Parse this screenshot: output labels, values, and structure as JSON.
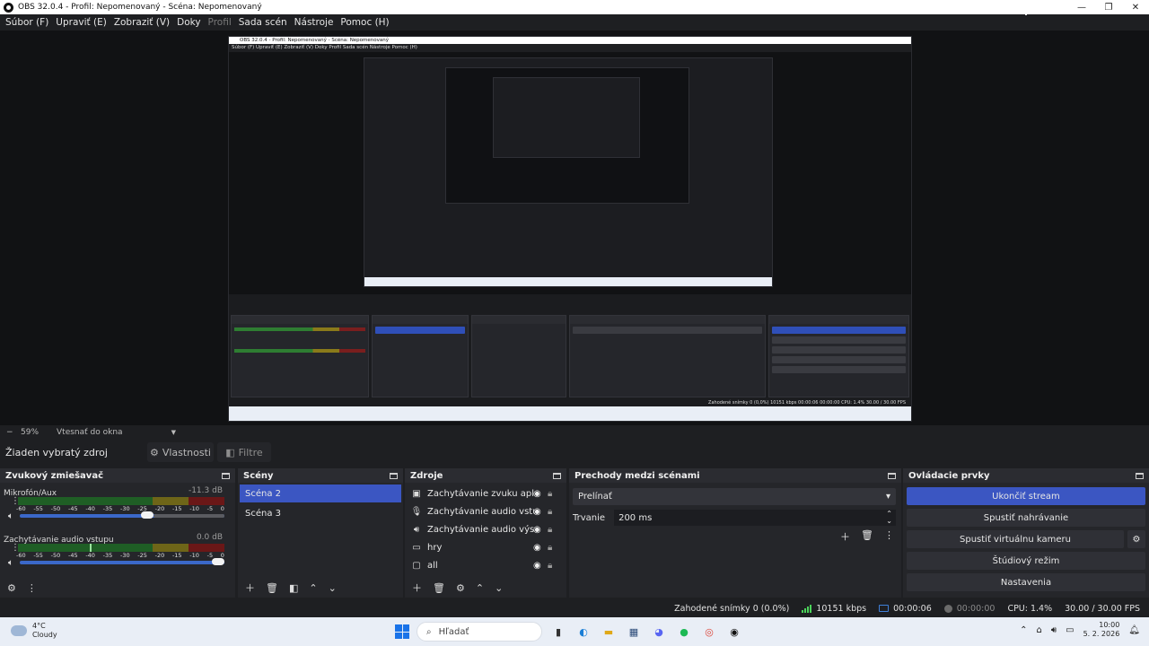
{
  "window": {
    "title": "OBS 32.0.4 - Profil: Nepomenovaný - Scéna: Nepomenovaný",
    "minimize": "—",
    "maximize": "❐",
    "close": "✕"
  },
  "menu": [
    {
      "label": "Súbor (F)",
      "disabled": false
    },
    {
      "label": "Upraviť (E)",
      "disabled": false
    },
    {
      "label": "Zobraziť (V)",
      "disabled": false
    },
    {
      "label": "Doky",
      "disabled": false
    },
    {
      "label": "Profil",
      "disabled": true
    },
    {
      "label": "Sada scén",
      "disabled": false
    },
    {
      "label": "Nástroje",
      "disabled": false
    },
    {
      "label": "Pomoc (H)",
      "disabled": false
    }
  ],
  "preview": {
    "nested_title": "OBS 32.0.4 - Profil: Nepomenovaný - Scéna: Nepomenovaný",
    "nested_menu": "Súbor (F)   Upraviť (E)   Zobraziť (V)   Doky   Profil   Sada scén   Nástroje   Pomoc (H)",
    "nested_status": "Zahodené snímky 0 (0,0%)   10151 kbps   00:00:06   00:00:00   CPU: 1.4%   30.00 / 30.00 FPS"
  },
  "zoom": {
    "minus": "−",
    "value": "59%",
    "fit": "Vtesnať do okna",
    "dropdown": "▼"
  },
  "source_toolbar": {
    "no_source": "Žiaden vybratý zdroj",
    "properties": "Vlastnosti",
    "filters": "Filtre"
  },
  "mixer": {
    "title": "Zvukový zmiešavač",
    "ticks": [
      "-60",
      "-55",
      "-50",
      "-45",
      "-40",
      "-35",
      "-30",
      "-25",
      "-20",
      "-15",
      "-10",
      "-5",
      "0"
    ],
    "tracks": [
      {
        "name": "Mikrofón/Aux",
        "db": "-11.3 dB",
        "volume": 0.63
      },
      {
        "name": "Zachytávanie audio vstupu",
        "db": "0.0 dB",
        "volume": 1.0
      }
    ]
  },
  "scenes": {
    "title": "Scény",
    "items": [
      {
        "label": "Scéna 2",
        "selected": true
      },
      {
        "label": "Scéna 3",
        "selected": false
      }
    ]
  },
  "sources": {
    "title": "Zdroje",
    "items": [
      {
        "label": "Zachytávanie zvuku aplikácie (",
        "icon": "app-audio-icon"
      },
      {
        "label": "Zachytávanie audio vstupu",
        "icon": "microphone-icon"
      },
      {
        "label": "Zachytávanie audio výstupu",
        "icon": "speaker-icon"
      },
      {
        "label": "hry",
        "icon": "window-capture-icon"
      },
      {
        "label": "all",
        "icon": "display-capture-icon"
      }
    ]
  },
  "transitions": {
    "title": "Prechody medzi scénami",
    "selected": "Prelínať",
    "duration_label": "Trvanie",
    "duration_value": "200 ms"
  },
  "controls": {
    "title": "Ovládacie prvky",
    "buttons": [
      {
        "label": "Ukončiť stream",
        "primary": true
      },
      {
        "label": "Spustiť nahrávanie",
        "primary": false
      },
      {
        "label": "Spustiť virtuálnu kameru",
        "primary": false
      },
      {
        "label": "Štúdiový režim",
        "primary": false
      },
      {
        "label": "Nastavenia",
        "primary": false
      }
    ]
  },
  "status": {
    "dropped": "Zahodené snímky 0 (0.0%)",
    "bitrate": "10151 kbps",
    "stream_time": "00:00:06",
    "rec_time": "00:00:00",
    "cpu": "CPU: 1.4%",
    "fps": "30.00 / 30.00 FPS"
  },
  "taskbar": {
    "weather_temp": "4°C",
    "weather_desc": "Cloudy",
    "search": "Hľadať",
    "time": "10:00",
    "date": "5. 2. 2026"
  },
  "colors": {
    "accent": "#3b56c2",
    "meter_green": "#1f5e25",
    "meter_yellow": "#6e6518",
    "meter_red": "#6a1717"
  }
}
